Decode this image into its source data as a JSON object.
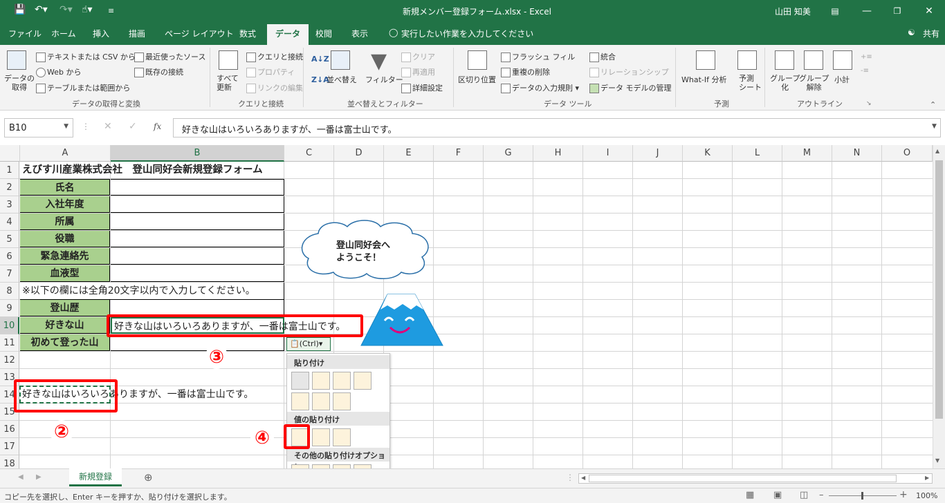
{
  "window": {
    "title": "新規メンバー登録フォーム.xlsx - Excel",
    "user": "山田 知美"
  },
  "tabs": [
    {
      "label": "ファイル"
    },
    {
      "label": "ホーム"
    },
    {
      "label": "挿入"
    },
    {
      "label": "描画"
    },
    {
      "label": "ページ レイアウト"
    },
    {
      "label": "数式"
    },
    {
      "label": "データ"
    },
    {
      "label": "校閲"
    },
    {
      "label": "表示"
    }
  ],
  "tell_me": "実行したい作業を入力してください",
  "share": "共有",
  "ribbon": {
    "get_data": "データの\n取得",
    "text_csv": "テキストまたは CSV から",
    "web": "Web から",
    "table_range": "テーブルまたは範囲から",
    "recent_sources": "最近使ったソース",
    "existing_conn": "既存の接続",
    "group_get": "データの取得と変換",
    "refresh_all": "すべて\n更新",
    "queries_conn": "クエリと接続",
    "properties": "プロパティ",
    "edit_links": "リンクの編集",
    "group_queries": "クエリと接続",
    "sort": "並べ替え",
    "filter": "フィルター",
    "clear": "クリア",
    "reapply": "再適用",
    "advanced": "詳細設定",
    "group_sort": "並べ替えとフィルター",
    "text_to_columns": "区切り位置",
    "flash_fill": "フラッシュ フィル",
    "remove_dup": "重複の削除",
    "data_validation": "データの入力規則",
    "consolidate": "統合",
    "relationships": "リレーションシップ",
    "data_model": "データ モデルの管理",
    "group_tools": "データ ツール",
    "whatif": "What-If 分析",
    "forecast_sheet": "予測\nシート",
    "group_forecast": "予測",
    "group": "グループ\n化",
    "ungroup": "グループ\n解除",
    "subtotal": "小計",
    "group_outline": "アウトライン"
  },
  "formula_bar": {
    "name_box": "B10",
    "fx": "fx",
    "value": "好きな山はいろいろありますが、一番は富士山です。"
  },
  "columns": [
    "A",
    "B",
    "C",
    "D",
    "E",
    "F",
    "G",
    "H",
    "I",
    "J",
    "K",
    "L",
    "M",
    "N",
    "O"
  ],
  "rows": [
    "1",
    "2",
    "3",
    "4",
    "5",
    "6",
    "7",
    "8",
    "9",
    "10",
    "11",
    "12",
    "13",
    "14",
    "15",
    "16",
    "17",
    "18"
  ],
  "cells": {
    "A1": "えびす川産業株式会社　登山同好会新規登録フォーム",
    "A2": "氏名",
    "A3": "入社年度",
    "A4": "所属",
    "A5": "役職",
    "A6": "緊急連絡先",
    "A7": "血液型",
    "A8": "※以下の欄には全角20文字以内で入力してください。",
    "A9": "登山歴",
    "A10": "好きな山",
    "B10": "好きな山はいろいろありますが、一番は富士山です。",
    "A11": "初めて登った山",
    "A14": "好きな山はいろいろありますが、一番は富士山です。"
  },
  "callout": "登山同好会へ\nようこそ！",
  "paste_ctrl": "(Ctrl)",
  "paste_menu": {
    "paste": "貼り付け",
    "paste_values": "値の貼り付け",
    "other_options": "その他の貼り付けオプション"
  },
  "markers": {
    "m2": "②",
    "m3": "③",
    "m4": "④"
  },
  "sheet_tab": "新規登録",
  "status": {
    "message": "コピー先を選択し、Enter キーを押すか、貼り付けを選択します。",
    "zoom": "100%"
  },
  "colors": {
    "excel_green": "#217346",
    "header_fill": "#a9d08e",
    "highlight_red": "#ff0000",
    "fuji_blue": "#1e9be0"
  }
}
